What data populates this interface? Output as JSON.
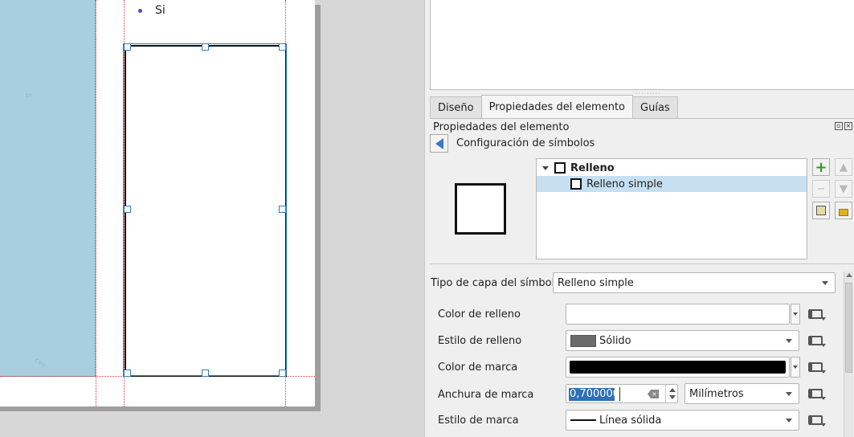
{
  "canvas": {
    "legend_item": "Si",
    "map_marks": [
      "sn",
      "ceo"
    ]
  },
  "panel": {
    "tabs": [
      "Diseño",
      "Propiedades del elemento",
      "Guías"
    ],
    "active_tab": "Propiedades del elemento",
    "dock_title": "Propiedades del elemento",
    "symbol_config_label": "Configuración de símbolos",
    "layer_tree": [
      {
        "label": "Relleno",
        "bold": true,
        "expanded": true,
        "selected": false
      },
      {
        "label": "Relleno simple",
        "bold": false,
        "selected": true
      }
    ],
    "side_buttons": {
      "add": "+",
      "remove": "−",
      "up": "▲",
      "down": "▼"
    },
    "symbol_layer_type_label": "Tipo de capa del símbolo",
    "symbol_layer_type_value": "Relleno simple",
    "fill_color_label": "Color de relleno",
    "fill_color_value": "#ffffff",
    "fill_style_label": "Estilo de relleno",
    "fill_style_value": "Sólido",
    "stroke_color_label": "Color de marca",
    "stroke_color_value": "#000000",
    "stroke_width_label": "Anchura de marca",
    "stroke_width_value": "0,700000",
    "stroke_width_unit": "Milímetros",
    "stroke_style_label": "Estilo de marca",
    "stroke_style_value": "Línea sólida"
  },
  "colors": {
    "map_fill": "#a8cfdf",
    "selection": "#c6dff1",
    "accent": "#2d6fb8"
  }
}
